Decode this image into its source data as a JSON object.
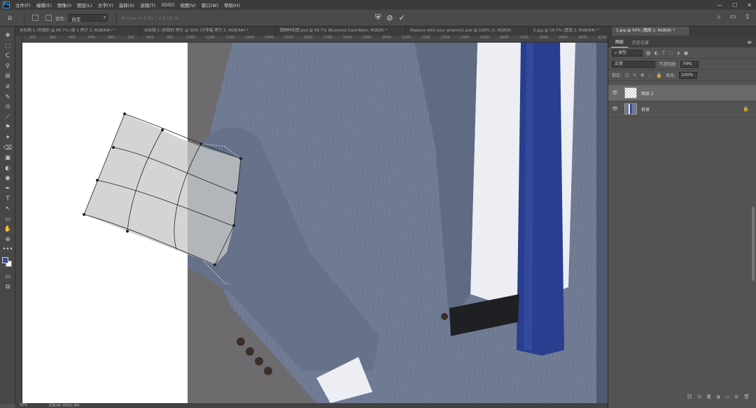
{
  "menubar": {
    "logo": "Ps",
    "items": [
      "文件(F)",
      "编辑(E)",
      "图像(I)",
      "图层(L)",
      "文字(Y)",
      "选择(S)",
      "滤镜(T)",
      "3D(D)",
      "视图(V)",
      "窗口(W)",
      "帮助(H)"
    ],
    "window_controls": [
      "—",
      "☐",
      "✕"
    ]
  },
  "options": {
    "home_icon": "⌂",
    "warp_label": "变形:",
    "warp_value": "自定",
    "dims_text": "⊞ 0 px  ↔ 0.00 °  v 0.00 %",
    "cancel_icon": "⊘",
    "commit_icon": "✓",
    "transform_icon": "⛨",
    "right_icons": [
      "⌕",
      "▭",
      "⇪"
    ]
  },
  "tabs": [
    "未标题-1 (你我的 @ 66.7% (组 1 拷贝 2, RGB/8#) *",
    "未标题-1 (你我的 拷贝 @ 50% (行李箱 拷贝 3, RGB/8#) *",
    "围棋样机图.psd @ 66.7% (Business Card Back, RGB/8) *",
    "Replace with your artwork1.psb @ 100% (1, RGB/8)",
    "2.jpg @ 16.7% (图层 2, RGB/8#) *",
    "1.jpg @ 50% (图层 2, RGB/8) *"
  ],
  "active_tab": 5,
  "tools": [
    "✥",
    "⬚",
    "ᑕ",
    "⚲",
    "⊞",
    "⧄",
    "✎",
    "⊙",
    "⟋",
    "⚑",
    "✦",
    "⌫",
    "▣",
    "◐",
    "◉",
    "✒",
    "T",
    "↖",
    "▭",
    "✋",
    "⊕",
    "•••"
  ],
  "ruler_ticks": [
    "200",
    "300",
    "400",
    "500",
    "600",
    "700",
    "800",
    "900",
    "1000",
    "1100",
    "1200",
    "1300",
    "1400",
    "1500",
    "1600",
    "1700",
    "1800",
    "1900",
    "2000",
    "2100",
    "2200",
    "2300",
    "2400",
    "2500",
    "2600",
    "2700",
    "2800",
    "2900",
    "3000",
    "3100"
  ],
  "status": {
    "zoom": "50%",
    "doc": "文档:66.7M/51.8M"
  },
  "layers_panel": {
    "tabs": [
      "图层",
      "历史记录"
    ],
    "menu_icon": "≡",
    "filter_label": "⌕ 类型",
    "filter_icons": [
      "▦",
      "◐",
      "T",
      "⬚",
      "◈",
      "●"
    ],
    "blend_mode": "正常",
    "opacity_label": "不透明度:",
    "opacity_value": "74%",
    "lock_label": "锁定:",
    "lock_icons": [
      "⊡",
      "✎",
      "✥",
      "⬚",
      "🔒"
    ],
    "fill_label": "填充:",
    "fill_value": "100%",
    "layers": [
      {
        "name": "图层 2",
        "selected": true,
        "locked": false
      },
      {
        "name": "背景",
        "selected": false,
        "locked": true
      }
    ],
    "footer_icons": [
      "⛓",
      "fx",
      "◘",
      "◑",
      "▭",
      "⊞",
      "🗑"
    ]
  },
  "colors": {
    "foreground": "#3c4ea3",
    "background": "#ffffff",
    "suit": "#6d7890",
    "tie": "#2a3e90"
  }
}
